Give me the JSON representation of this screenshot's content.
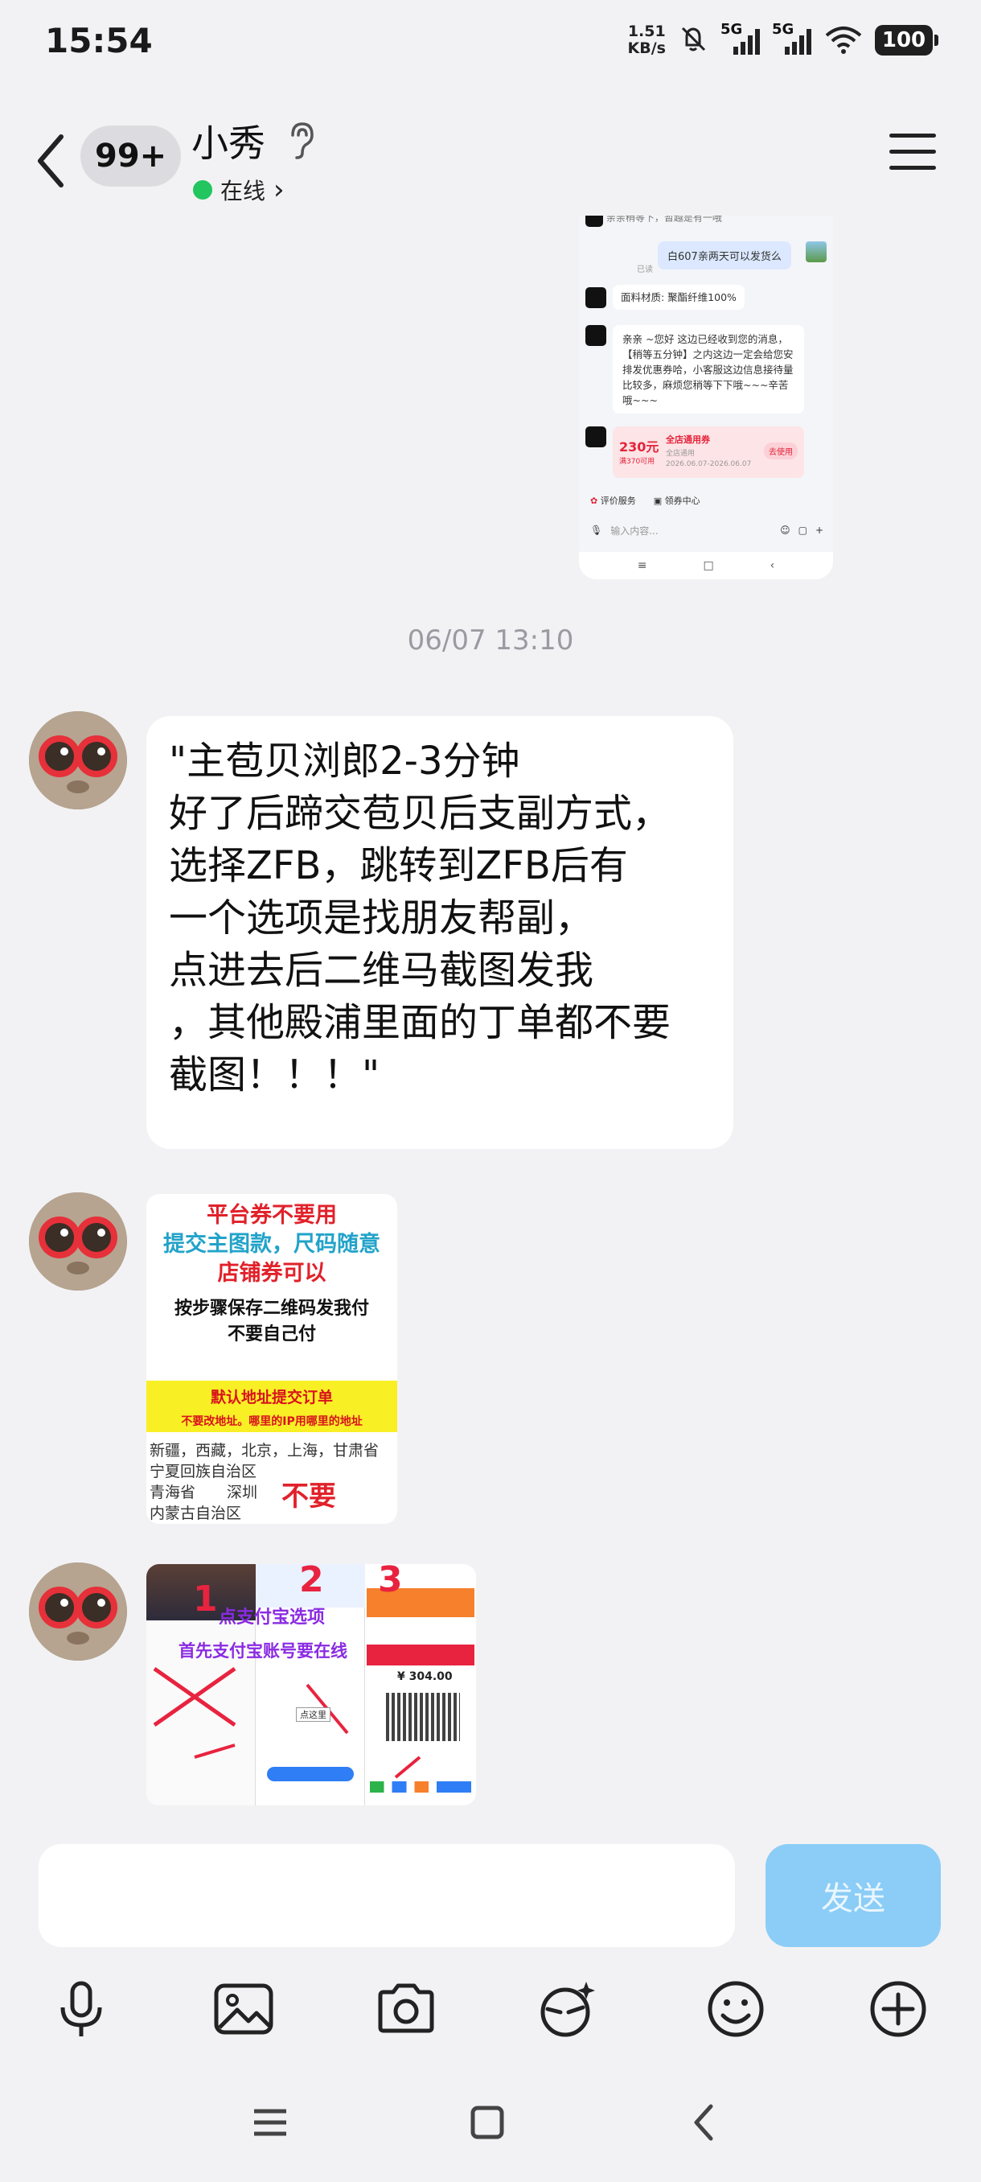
{
  "status_bar": {
    "time": "15:54",
    "net_speed_value": "1.51",
    "net_speed_unit": "KB/s",
    "sig1": "5G",
    "sig2": "5G",
    "battery": "100"
  },
  "header": {
    "badge": "99+",
    "contact_name": "小秀",
    "online_label": "在线",
    "online_chevron": "›"
  },
  "shared_screenshot": {
    "top_cut": "亲亲稍等下，暂越是有一哦",
    "user_msg": "白607亲两天可以发货么",
    "line_label": "已读",
    "material": "面料材质: 聚酯纤维100%",
    "reply": "亲亲 ~您好 这边已经收到您的消息，【稍等五分钟】之内这边一定会给您安排发优惠券哈，小客服这边信息接待量比较多，麻烦您稍等下下哦~~~辛苦哦~~~",
    "coupon_amount": "230元",
    "coupon_cond": "满370可用",
    "coupon_title": "全店通用券",
    "coupon_scope": "全店通用",
    "coupon_date": "2026.06.07-2026.06.07",
    "coupon_btn": "去使用",
    "eval_label": "评价服务",
    "coupon_center": "领券中心",
    "input_placeholder": "输入内容..."
  },
  "timestamp": "06/07 13:10",
  "message": {
    "lines": [
      "\"主苞贝浏郎2-3分钟",
      "好了后蹄交苞贝后支副方式，",
      "选择ZFB，跳转到ZFB后有",
      "一个选项是找朋友帮副，",
      "点进去后二维马截图发我",
      "，其他殿浦里面的丁单都不要",
      "截图！！！\""
    ]
  },
  "image1": {
    "line1": "平台券不要用",
    "line2": "提交主图款，尺码随意",
    "line3": "店铺券可以",
    "line4": "按步骤保存二维码发我付",
    "line5": "不要自己付",
    "yellow1": "默认地址提交订单",
    "red1": "不要改地址。哪里的IP用哪里的地址",
    "regions1": "新疆，西藏，北京，上海，甘肃省",
    "regions2": "宁夏回族自治区",
    "regions3": "青海省",
    "regions3b": "深圳",
    "regions4": "内蒙古自治区",
    "no": "不要"
  },
  "image2": {
    "n1": "1",
    "n2": "2",
    "n3": "3",
    "caption1": "点支付宝选项",
    "caption2": "首先支付宝账号要在线",
    "amount": "¥ 304.00",
    "btn": "点这里"
  },
  "composer": {
    "placeholder": "",
    "send": "发送"
  }
}
